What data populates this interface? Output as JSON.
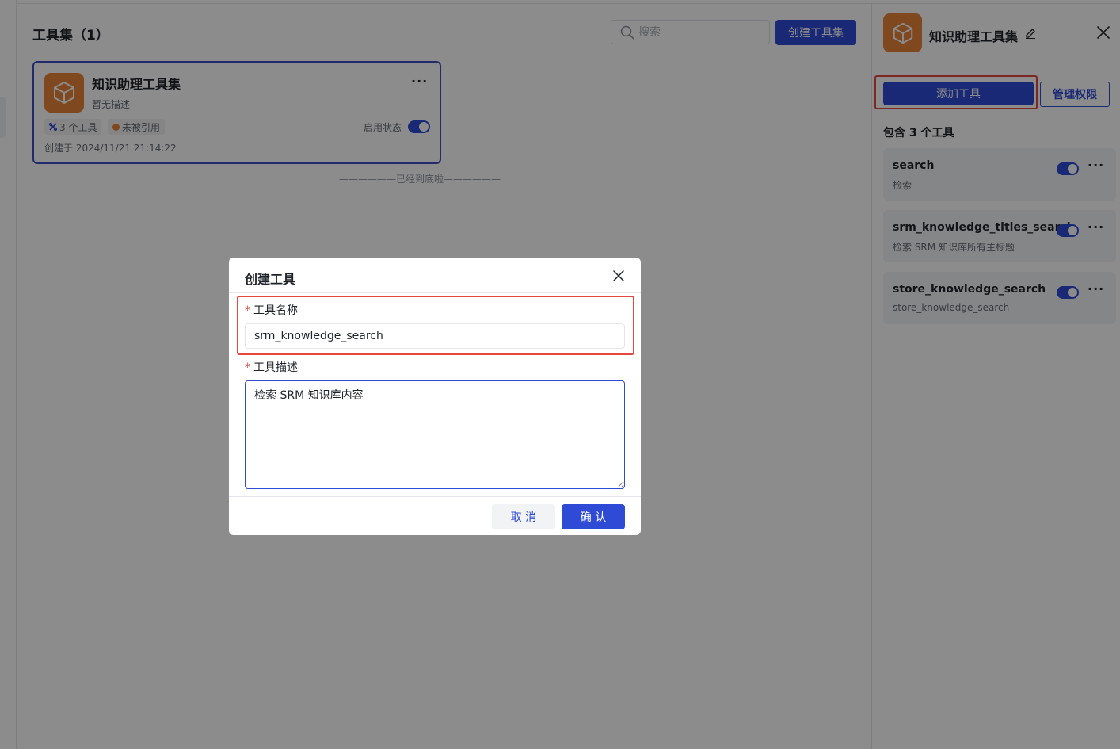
{
  "main": {
    "title": "工具集（1）",
    "search_placeholder": "搜索",
    "create_button": "创建工具集",
    "end_text": "——————已经到底啦——————",
    "card": {
      "title": "知识助理工具集",
      "description": "暂无描述",
      "tools_tag": "3 个工具",
      "ref_tag": "未被引用",
      "status_label": "启用状态",
      "enabled": true,
      "created": "创建于 2024/11/21 21:14:22"
    }
  },
  "drawer": {
    "title": "知识助理工具集",
    "add_tool_button": "添加工具",
    "manage_button": "管理权限",
    "contains_label": "包含 3 个工具",
    "tools": [
      {
        "name": "search",
        "description": "检索",
        "enabled": true
      },
      {
        "name": "srm_knowledge_titles_search",
        "description": "检索 SRM 知识库所有主标题",
        "enabled": true
      },
      {
        "name": "store_knowledge_search",
        "description": "store_knowledge_search",
        "enabled": true
      }
    ]
  },
  "modal": {
    "title": "创建工具",
    "name_label": "工具名称",
    "name_value": "srm_knowledge_search",
    "desc_label": "工具描述",
    "desc_value": "检索 SRM 知识库内容",
    "required_mark": "*",
    "cancel_button": "取 消",
    "confirm_button": "确 认"
  },
  "colors": {
    "primary": "#2f4bd6",
    "brand_orange": "#e8843a",
    "highlight_red": "#e4483f"
  },
  "icons": [
    "search-icon",
    "cube-icon",
    "edit-icon",
    "close-icon",
    "more-icon",
    "tools-icon"
  ]
}
